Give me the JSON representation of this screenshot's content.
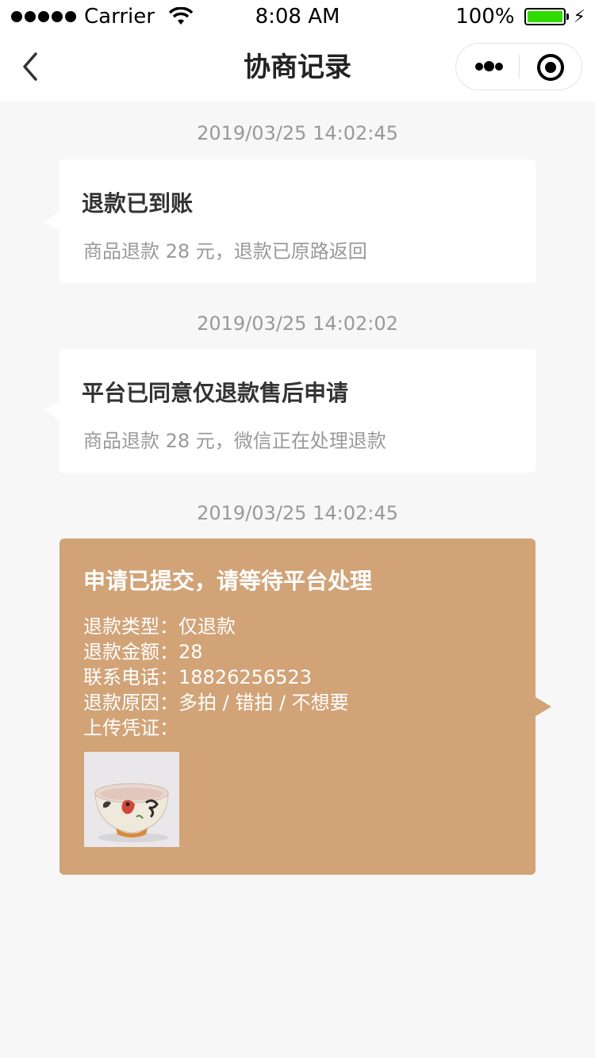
{
  "status_bar": {
    "carrier": "Carrier",
    "time": "8:08 AM",
    "battery": "100%",
    "battery_level": 1.0,
    "battery_color": "#2fdc00"
  },
  "nav": {
    "title": "协商记录",
    "icons": [
      "chevron-left-icon",
      "more-dots-icon",
      "close-target-icon"
    ]
  },
  "records": [
    {
      "timestamp": "2019/03/25  14:02:45",
      "title": "退款已到账",
      "desc": "商品退款 28 元，退款已原路返回"
    },
    {
      "timestamp": "2019/03/25  14:02:02",
      "title": "平台已同意仅退款售后申请",
      "desc": "商品退款 28 元，微信正在处理退款"
    }
  ],
  "submitted": {
    "timestamp": "2019/03/25  14:02:45",
    "title": "申请已提交，请等待平台处理",
    "color": "#d1a377",
    "details": [
      {
        "label": "退款类型：",
        "value": "仅退款"
      },
      {
        "label": "退款金额：",
        "value": "28"
      },
      {
        "label": "联系电话：",
        "value": "18826256523"
      },
      {
        "label": "退款原因：",
        "value": "多拍 / 错拍 / 不想要"
      },
      {
        "label": "上传凭证：",
        "value": ""
      }
    ],
    "proof_image": "ceramic-bowl-photo"
  }
}
